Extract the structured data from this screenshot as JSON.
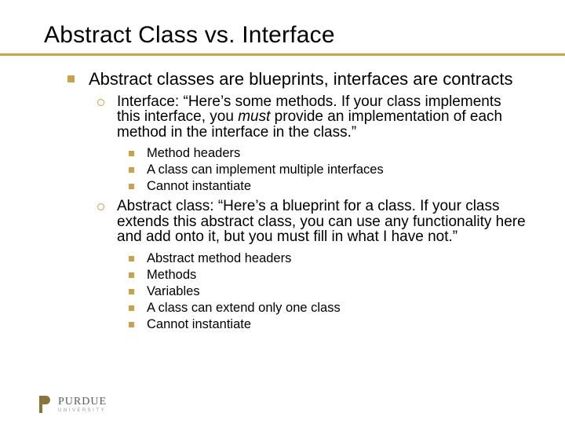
{
  "title": "Abstract Class vs. Interface",
  "main": {
    "text": "Abstract classes are blueprints, interfaces are contracts"
  },
  "interface": {
    "lead": "Interface:  “Here’s some methods.  If your class implements this interface, you ",
    "must": "must",
    "tail": " provide an implementation of each method in the interface in the class.”",
    "points": {
      "p1": "Method headers",
      "p2": "A class can implement multiple interfaces",
      "p3": "Cannot instantiate"
    }
  },
  "abstract": {
    "text": "Abstract class:  “Here’s a blueprint for a class.  If your class extends this abstract class, you can use any functionality here and add onto it, but you must fill in what I have not.”",
    "points": {
      "p1": "Abstract method headers",
      "p2": "Methods",
      "p3": "Variables",
      "p4": "A class can extend only one class",
      "p5": "Cannot instantiate"
    }
  },
  "logo": {
    "name": "PURDUE",
    "sub": "UNIVERSITY"
  },
  "colors": {
    "accent": "#c9a24a"
  }
}
